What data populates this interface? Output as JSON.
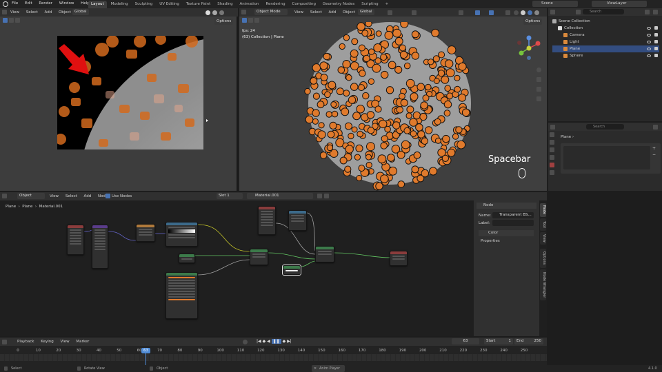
{
  "topbar": {
    "menus": [
      "File",
      "Edit",
      "Render",
      "Window",
      "Help"
    ],
    "workspaces": [
      "Layout",
      "Modeling",
      "Sculpting",
      "UV Editing",
      "Texture Paint",
      "Shading",
      "Animation",
      "Rendering",
      "Compositing",
      "Geometry Nodes",
      "Scripting"
    ],
    "add_tab": "+",
    "scene": "Scene",
    "view_layer": "ViewLayer"
  },
  "image_editor": {
    "menus": [
      "View",
      "Select",
      "Add",
      "Object"
    ],
    "orientation": "Global",
    "options": "Options"
  },
  "viewport": {
    "mode": "Object Mode",
    "menus": [
      "View",
      "Select",
      "Add",
      "Object"
    ],
    "orientation": "Global",
    "options": "Options",
    "fps": "fps: 24",
    "info": "(63) Collection | Plane",
    "key_overlay": "Spacebar"
  },
  "outliner": {
    "search_placeholder": "Search",
    "rows": [
      {
        "label": "Scene Collection",
        "indent": 0
      },
      {
        "label": "Collection",
        "indent": 1
      },
      {
        "label": "Camera",
        "indent": 2
      },
      {
        "label": "Light",
        "indent": 2
      },
      {
        "label": "Plane",
        "indent": 2
      },
      {
        "label": "Sphere",
        "indent": 2
      }
    ]
  },
  "properties": {
    "search_placeholder": "Search",
    "object": "Plane"
  },
  "node_editor": {
    "object_mode": "Object",
    "menus": [
      "View",
      "Select",
      "Add",
      "Node"
    ],
    "use_nodes": "Use Nodes",
    "slot": "Slot 1",
    "material": "Material.001",
    "breadcrumb": [
      "Plane",
      "Plane",
      "Material.001"
    ],
    "sidebar": {
      "section": "Node",
      "name_label": "Name:",
      "name_value": "Transparent BS...",
      "label_label": "Label:",
      "color": "Color",
      "properties": "Properties"
    },
    "vtabs": [
      "Node",
      "Tool",
      "View",
      "Options",
      "Node Wrangler"
    ]
  },
  "timeline": {
    "menus": [
      "Playback",
      "Keying",
      "View",
      "Marker"
    ],
    "current_frame": "63",
    "start_label": "Start",
    "start": "1",
    "end_label": "End",
    "end": "250",
    "ticks": [
      "0",
      "10",
      "20",
      "30",
      "40",
      "50",
      "60",
      "70",
      "80",
      "90",
      "100",
      "110",
      "120",
      "130",
      "140",
      "150",
      "160",
      "170",
      "180",
      "190",
      "200",
      "210",
      "220",
      "230",
      "240",
      "250"
    ],
    "playhead": "63"
  },
  "statusbar": {
    "select": "Select",
    "rotate": "Rotate View",
    "object": "Object",
    "anim_player": "Anim Player",
    "version": "4.1.0"
  },
  "colors": {
    "accent": "#4772b3",
    "orange": "#e07a2c",
    "active_blue": "#2c5d9c",
    "shader_green": "#3c7a4a",
    "input_red": "#8a3c3c",
    "playhead": "#4f8bd6"
  }
}
